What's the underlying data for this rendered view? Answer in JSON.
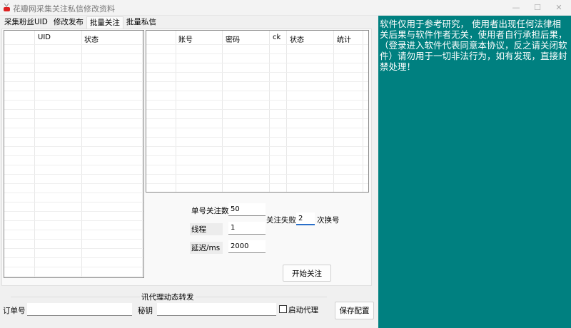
{
  "window": {
    "title": "花瓣网采集关注私信修改资料",
    "minimize": "—",
    "maximize": "☐",
    "close": "✕"
  },
  "tabs": [
    {
      "label": "采集粉丝UID"
    },
    {
      "label": "修改发布"
    },
    {
      "label": "批量关注",
      "active": true
    },
    {
      "label": "批量私信"
    }
  ],
  "uid_table": {
    "columns": [
      "",
      "UID",
      "状态"
    ],
    "rows": []
  },
  "account_table": {
    "columns": [
      "",
      "账号",
      "密码",
      "ck",
      "状态",
      "统计"
    ],
    "rows": []
  },
  "settings": {
    "follow_count_label": "单号关注数",
    "follow_count": "50",
    "fail_label": "关注失败",
    "fail_count": "2",
    "fail_suffix": "次换号",
    "threads_label": "线程",
    "threads": "1",
    "delay_label": "延迟/ms",
    "delay": "2000",
    "start_button": "开始关注"
  },
  "proxy": {
    "group_label": "讯代理动态转发",
    "order_label": "订单号",
    "order_value": "",
    "key_label": "秘钥",
    "key_value": "",
    "enable_label": "启动代理",
    "enabled": false,
    "save_button": "保存配置"
  },
  "notice": "软件仅用于参考研究， 使用者出现任何法律相关后果与软件作者无关，使用者自行承担后果，（登录进入软件代表同意本协议，反之请关闭软件）请勿用于一切非法行为，如有发现，直接封禁处理！",
  "colors": {
    "notice_bg": "#008080"
  }
}
